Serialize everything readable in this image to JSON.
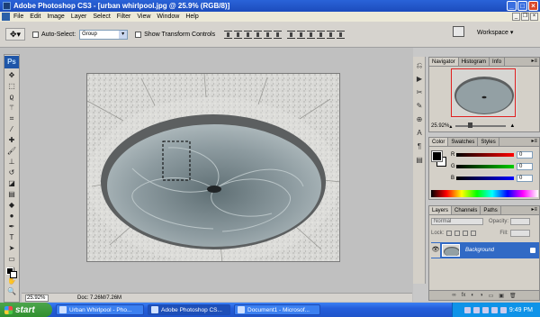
{
  "window": {
    "title": "Adobe Photoshop CS3 - [urban whirlpool.jpg @ 25.9% (RGB/8)]"
  },
  "menubar": {
    "items": [
      "File",
      "Edit",
      "Image",
      "Layer",
      "Select",
      "Filter",
      "View",
      "Window",
      "Help"
    ]
  },
  "options": {
    "auto_select_label": "Auto-Select:",
    "auto_select_value": "Group",
    "show_transform_label": "Show Transform Controls",
    "workspace_label": "Workspace ▾"
  },
  "toolbox": {
    "logo": "Ps"
  },
  "status": {
    "zoom": "25.92%",
    "doc": "Doc: 7.26M/7.26M"
  },
  "navigator": {
    "tabs": [
      "Navigator",
      "Histogram",
      "Info"
    ],
    "zoom": "25.92%"
  },
  "color_panel": {
    "tabs": [
      "Color",
      "Swatches",
      "Styles"
    ],
    "channels": [
      {
        "label": "R",
        "value": "0"
      },
      {
        "label": "G",
        "value": "0"
      },
      {
        "label": "B",
        "value": "0"
      }
    ]
  },
  "layers_panel": {
    "tabs": [
      "Layers",
      "Channels",
      "Paths"
    ],
    "blend_mode": "Normal",
    "opacity_label": "Opacity:",
    "lock_label": "Lock:",
    "fill_label": "Fill:",
    "layer_name": "Background",
    "footer_icons": [
      "∞",
      "fx",
      "◐",
      "◑",
      "▭",
      "▣",
      "🗑"
    ]
  },
  "taskbar": {
    "start_label": "start",
    "tasks": [
      "Urban Whirlpool - Pho...",
      "Adobe Photoshop CS...",
      "Document1 - Microsof..."
    ],
    "clock": "9:49 PM"
  }
}
